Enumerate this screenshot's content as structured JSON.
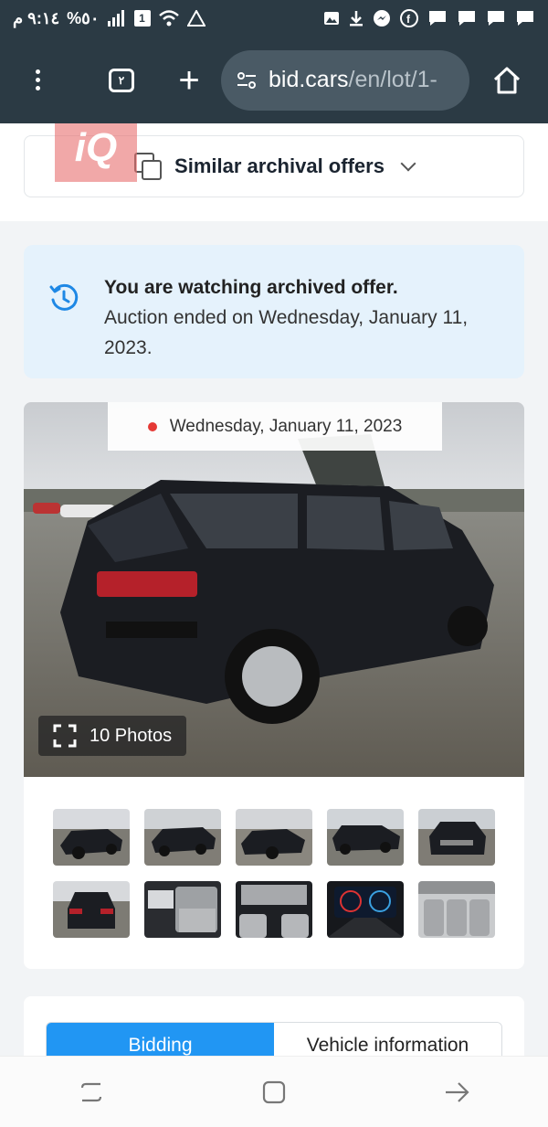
{
  "status_bar": {
    "time": "٩:١٤ م",
    "battery": "%٥٠",
    "notification_icons": [
      "image-icon",
      "download-icon",
      "messenger-icon",
      "facebook-icon",
      "chat-icon",
      "chat-icon",
      "chat-icon",
      "chat-icon"
    ]
  },
  "browser": {
    "tab_count": "٢",
    "url_host": "bid.cars",
    "url_path": "/en/lot/1-"
  },
  "similar": {
    "label": "Similar archival offers",
    "watermark": "iQ"
  },
  "archive_notice": {
    "title": "You are watching archived offer.",
    "body": "Auction ended on Wednesday, January 11, 2023."
  },
  "gallery": {
    "date": "Wednesday, January 11, 2023",
    "photo_count_label": "10 Photos",
    "thumbnail_count": 10
  },
  "tabs": [
    {
      "label": "Bidding",
      "active": true
    },
    {
      "label": "Vehicle information",
      "active": false
    }
  ],
  "colors": {
    "accent": "#2196f3",
    "toolbar": "#2b3a44",
    "notice_bg": "#e5f2fc",
    "live_dot": "#e53935"
  }
}
